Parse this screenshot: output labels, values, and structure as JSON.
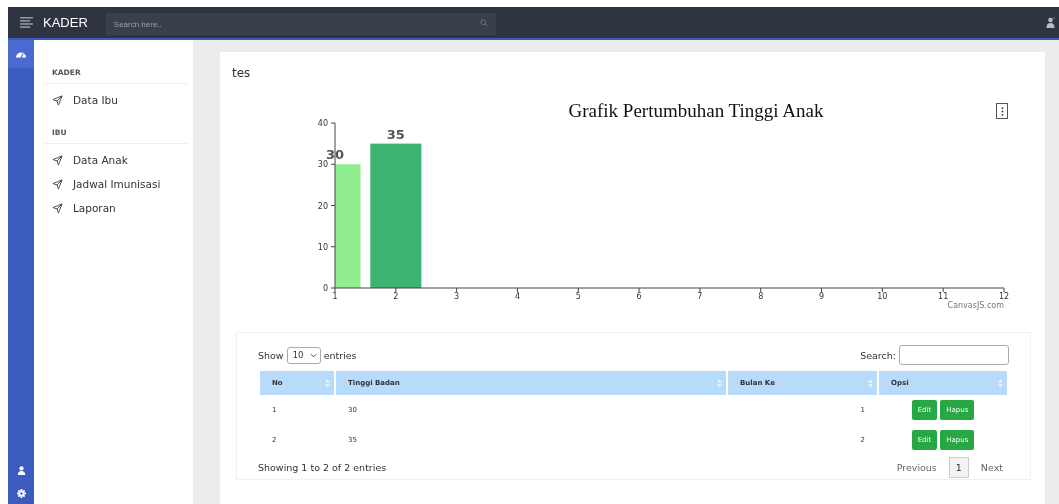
{
  "navbar": {
    "brand": "KADER",
    "search": {
      "placeholder": "Search here.."
    }
  },
  "sidebar": {
    "sections": [
      {
        "heading": "KADER",
        "items": [
          {
            "label": "Data Ibu"
          }
        ]
      },
      {
        "heading": "IBU",
        "items": [
          {
            "label": "Data Anak"
          },
          {
            "label": "Jadwal Imunisasi"
          },
          {
            "label": "Laporan"
          }
        ]
      }
    ]
  },
  "content": {
    "heading": "tes",
    "chart_data": {
      "type": "bar",
      "title": "Grafik Pertumbuhan Tinggi Anak",
      "x": [
        1,
        2
      ],
      "series": [
        {
          "color": "#90ee90",
          "values": [
            30,
            null
          ]
        },
        {
          "color": "#3cb371",
          "values": [
            null,
            35
          ]
        }
      ],
      "xlim": [
        1,
        12
      ],
      "ylim": [
        0,
        40
      ],
      "xticks": [
        1,
        2,
        3,
        4,
        5,
        6,
        7,
        8,
        9,
        10,
        11,
        12
      ],
      "yticks": [
        0,
        10,
        20,
        30,
        40
      ],
      "data_labels": true
    },
    "chart_credit": "CanvasJS.com"
  },
  "table": {
    "length_label_before": "Show",
    "length_value": "10",
    "length_label_after": "entries",
    "search_label": "Search:",
    "columns": [
      "No",
      "Tinggi Badan",
      "Bulan Ke",
      "Opsi"
    ],
    "rows": [
      {
        "no": "1",
        "tinggi_badan": "30",
        "bulan_ke": "1",
        "actions": [
          "Edit",
          "Hapus"
        ]
      },
      {
        "no": "2",
        "tinggi_badan": "35",
        "bulan_ke": "2",
        "actions": [
          "Edit",
          "Hapus"
        ]
      }
    ],
    "info": "Showing 1 to 2 of 2 entries",
    "pagination": {
      "previous": "Previous",
      "pages": [
        {
          "label": "1",
          "selected": true
        }
      ],
      "next": "Next"
    }
  }
}
